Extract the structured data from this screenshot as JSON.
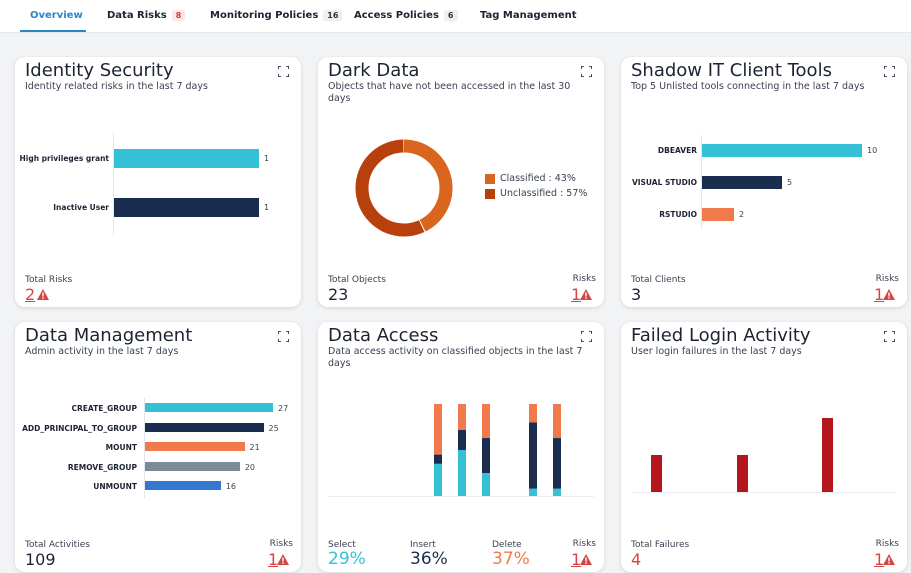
{
  "tabs": [
    {
      "label": "Overview",
      "badge": ""
    },
    {
      "label": "Data Risks",
      "badge": "8"
    },
    {
      "label": "Monitoring Policies",
      "badge": "16"
    },
    {
      "label": "Access Policies",
      "badge": "6"
    },
    {
      "label": "Tag Management",
      "badge": ""
    }
  ],
  "colors": {
    "accent": "#2b86c5",
    "cyan": "#34c1d8",
    "navy": "#1b2d4f",
    "orange": "#f07a4b",
    "darkorange": "#c9541a",
    "red": "#d64545",
    "crimson": "#b5161e",
    "slate": "#7b8a96",
    "blue": "#3578d4"
  },
  "cards": {
    "identity": {
      "title": "Identity Security",
      "subtitle": "Identity related risks in the last 7 days",
      "bars": [
        {
          "label": "High privileges grant",
          "value": 1,
          "color": "#34c1d8"
        },
        {
          "label": "Inactive User",
          "value": 1,
          "color": "#1b2d4f"
        }
      ],
      "footer_label": "Total Risks",
      "footer_value": "2"
    },
    "dark": {
      "title": "Dark Data",
      "subtitle": "Objects that have not been accessed in the last 30 days",
      "slices": [
        {
          "label": "Classified : 43%",
          "value": 43,
          "color": "#d9651e"
        },
        {
          "label": "Unclassified : 57%",
          "value": 57,
          "color": "#b8400d"
        }
      ],
      "footer_label": "Total Objects",
      "footer_value": "23",
      "risks_label": "Risks",
      "risks_value": "1"
    },
    "shadow": {
      "title": "Shadow IT Client Tools",
      "subtitle": "Top 5 Unlisted tools connecting in the last 7 days",
      "bars": [
        {
          "label": "DBEAVER",
          "value": 10,
          "color": "#34c1d8"
        },
        {
          "label": "VISUAL STUDIO",
          "value": 5,
          "color": "#1b2d4f"
        },
        {
          "label": "RSTUDIO",
          "value": 2,
          "color": "#f07a4b"
        }
      ],
      "footer_label": "Total Clients",
      "footer_value": "3",
      "risks_label": "Risks",
      "risks_value": "1"
    },
    "mgmt": {
      "title": "Data Management",
      "subtitle": "Admin activity in the last 7 days",
      "bars": [
        {
          "label": "CREATE_GROUP",
          "value": 27,
          "color": "#34c1d8"
        },
        {
          "label": "ADD_PRINCIPAL_TO_GROUP",
          "value": 25,
          "color": "#1b2d4f"
        },
        {
          "label": "MOUNT",
          "value": 21,
          "color": "#f07a4b"
        },
        {
          "label": "REMOVE_GROUP",
          "value": 20,
          "color": "#7b8a96"
        },
        {
          "label": "UNMOUNT",
          "value": 16,
          "color": "#3578d4"
        }
      ],
      "footer_label": "Total Activities",
      "footer_value": "109",
      "risks_label": "Risks",
      "risks_value": "1"
    },
    "access": {
      "title": "Data Access",
      "subtitle": "Data access activity on classified objects in the last 7 days",
      "stacks": [
        {
          "select": 0.35,
          "insert": 0.1,
          "delete": 0.55
        },
        {
          "select": 0.5,
          "insert": 0.22,
          "delete": 0.28
        },
        {
          "select": 0.25,
          "insert": 0.38,
          "delete": 0.37
        },
        {
          "select": 0.08,
          "insert": 0.72,
          "delete": 0.2
        },
        {
          "select": 0.08,
          "insert": 0.55,
          "delete": 0.37
        }
      ],
      "select_label": "Select",
      "select_value": "29%",
      "insert_label": "Insert",
      "insert_value": "36%",
      "delete_label": "Delete",
      "delete_value": "37%",
      "risks_label": "Risks",
      "risks_value": "1"
    },
    "failed": {
      "title": "Failed Login Activity",
      "subtitle": "User login failures in the last 7 days",
      "bars": [
        1,
        1,
        2
      ],
      "footer_label": "Total Failures",
      "footer_value": "4",
      "risks_label": "Risks",
      "risks_value": "1"
    }
  }
}
